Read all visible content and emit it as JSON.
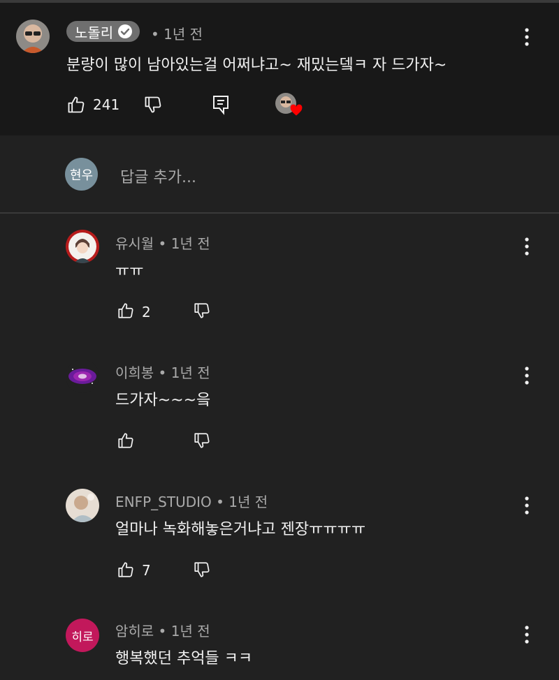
{
  "main": {
    "author": "노돌리",
    "time": "• 1년 전",
    "text": "분량이 많이 남아있는걸 어쩌냐고~ 재밌는뎈ㅋ 자 드가자~",
    "likes": "241"
  },
  "reply_box": {
    "avatar_text": "현우",
    "placeholder": "답글 추가..."
  },
  "replies": [
    {
      "author": "유시월",
      "time": " • 1년 전",
      "text": "ㅠㅠ",
      "likes": "2"
    },
    {
      "author": "이희봉",
      "time": " • 1년 전",
      "text": "드가자~~~읔",
      "likes": ""
    },
    {
      "author": "ENFP_STUDIO",
      "time": " • 1년 전",
      "text": "얼마나 녹화해놓은거냐고 젠장ㅠㅠㅠㅠ",
      "likes": "7"
    },
    {
      "author": "암히로",
      "time": " • 1년 전",
      "text": "행복했던 추억들 ㅋㅋ",
      "likes": "",
      "avatar_text": "히로"
    }
  ],
  "colors": {
    "background": "#212121",
    "main_background": "#181818",
    "text": "#f1f1f1",
    "meta": "#aaaaaa",
    "heart": "#ff0000",
    "hiro_avatar": "#c2185b",
    "hyunwoo_avatar": "#78909c"
  },
  "icons": {
    "like": "thumbs-up-icon",
    "dislike": "thumbs-down-icon",
    "reply": "reply-icon",
    "more": "more-vertical-icon",
    "verified": "verified-check-icon",
    "heart": "creator-heart-icon"
  }
}
